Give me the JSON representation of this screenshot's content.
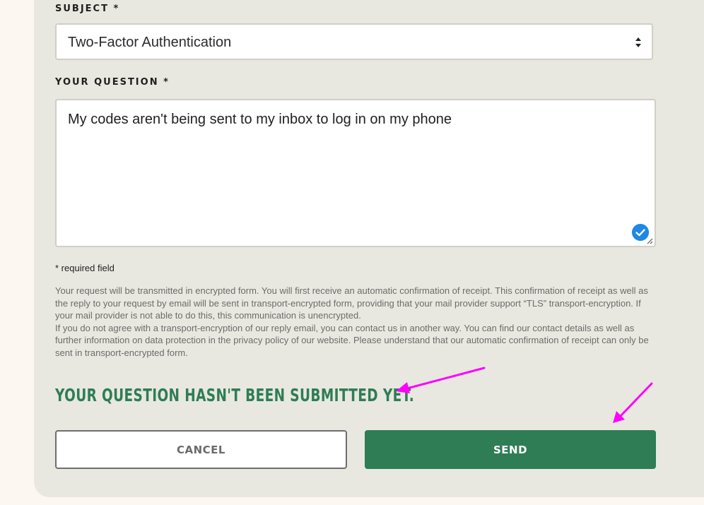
{
  "form": {
    "subject_label": "SUBJECT *",
    "subject_value": "Two-Factor Authentication",
    "question_label": "YOUR QUESTION *",
    "question_value": "My codes aren't being sent to my inbox to log in on my phone",
    "required_note": "* required field",
    "disclaimer_p1": "Your request will be transmitted in encrypted form. You will first receive an automatic confirmation of receipt. This confirmation of receipt as well as the reply to your request by email will be sent in transport-encrypted form, providing that your mail provider support “TLS” transport-encryption. If your mail provider is not able to do this, this communication is unencrypted.",
    "disclaimer_p2": "If you do not agree with a transport-encryption of our reply email, you can contact us in another way. You can find our contact details as well as further information on data protection in the privacy policy of our website. Please understand that our automatic confirmation of receipt can only be sent in transport-encrypted form.",
    "status_message": "YOUR QUESTION HASN'T BEEN SUBMITTED YET.",
    "cancel_label": "CANCEL",
    "send_label": "SEND"
  },
  "icons": {
    "select_arrows": "sort-arrows-icon",
    "grammar_check": "checkmark-circle-icon",
    "resize": "resize-handle-icon"
  },
  "colors": {
    "panel_bg": "#e9e8e0",
    "page_bg": "#fdf7f2",
    "brand_green": "#2e7d55",
    "annotation_magenta": "#ff00ff",
    "check_blue": "#1e88e5"
  }
}
